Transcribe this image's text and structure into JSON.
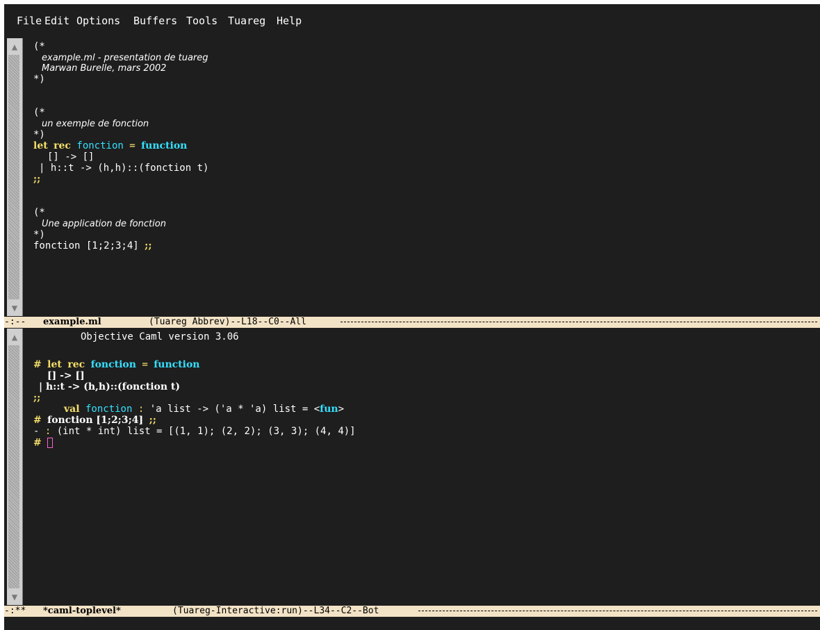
{
  "menubar": {
    "items": [
      {
        "label": "File"
      },
      {
        "label": "Edit"
      },
      {
        "label": "Options"
      },
      {
        "label": "Buffers"
      },
      {
        "label": "Tools"
      },
      {
        "label": "Tuareg"
      },
      {
        "label": "Help"
      }
    ]
  },
  "editor": {
    "c1_open": "(*",
    "c1_l1": "example.ml - presentation de tuareg",
    "c1_l2": "Marwan Burelle, mars 2002",
    "c1_close": "*)",
    "c2_open": "(*",
    "c2_l1": "un exemple de fonction",
    "c2_close": "*)",
    "code1_let": "let",
    "code1_rec": "rec",
    "code1_name": "fonction",
    "code1_eq": "=",
    "code1_function": "function",
    "code2": "[] -> []",
    "code3": "| h::t -> (h,h)::(fonction t)",
    "code4": ";;",
    "c3_open": "(*",
    "c3_l1": "Une application de fonction",
    "c3_close": "*)",
    "code5_call": "fonction [1;2;3;4]",
    "code5_term": ";;"
  },
  "modeline_top": {
    "flags": "-:--",
    "buffer": "example.ml",
    "mode": "(Tuareg Abbrev)--L18--C0--All"
  },
  "toplevel": {
    "version": "Objective Caml version 3.06",
    "p1_prompt": "#",
    "p1_let": "let",
    "p1_rec": "rec",
    "p1_name": "fonction",
    "p1_eq": "=",
    "p1_function": "function",
    "p2": "[] -> []",
    "p3": "| h::t -> (h,h)::(fonction t)",
    "p4": ";;",
    "r1_val": "val",
    "r1_name": "fonction",
    "r1_colon": ":",
    "r1_type": "'a list -> ('a * 'a) list =",
    "r1_fun_open": "<",
    "r1_fun": "fun",
    "r1_fun_close": ">",
    "p5_prompt": "#",
    "p5_call": "fonction [1;2;3;4]",
    "p5_term": ";;",
    "r2_dash": "-",
    "r2_colon": ":",
    "r2_result": "(int * int) list = [(1, 1); (2, 2); (3, 3); (4, 4)]",
    "p6_prompt": "#"
  },
  "modeline_bottom": {
    "flags": "-:**",
    "buffer": "*caml-toplevel*",
    "mode": "(Tuareg-Interactive:run)--L34--C2--Bot"
  },
  "colors": {
    "background": "#1e1e1e",
    "modeline": "#f3e3c6",
    "keyword": "#f6e06a",
    "function_name": "#33e0ff",
    "cursor": "#ff5fd7"
  }
}
